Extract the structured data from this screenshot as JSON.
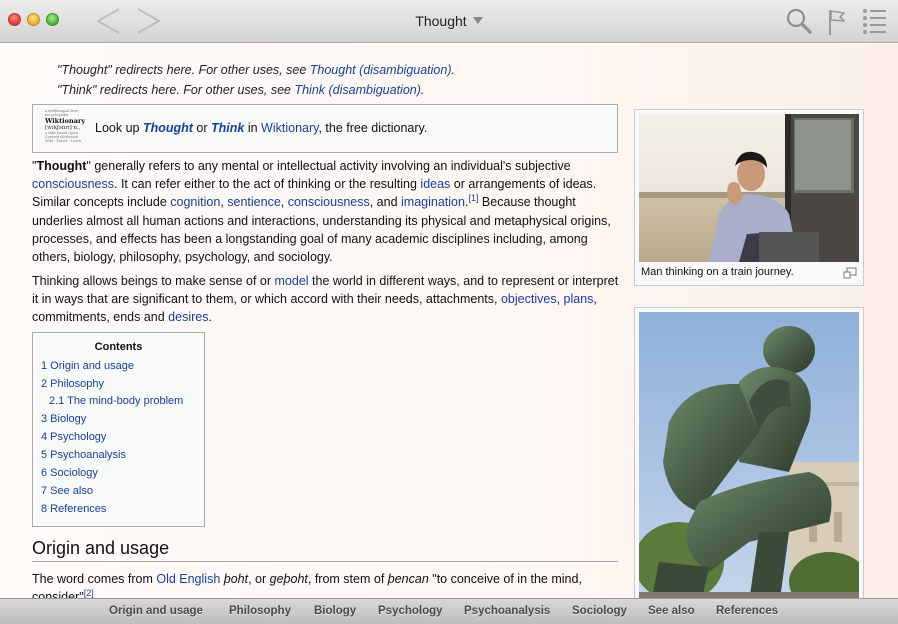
{
  "window": {
    "title": "Thought"
  },
  "hatnotes": [
    {
      "prefix": "\"Thought\" redirects here. For other uses, see ",
      "link": "Thought (disambiguation)",
      "suffix": "."
    },
    {
      "prefix": "\"Think\" redirects here. For other uses, see ",
      "link": "Think (disambiguation)",
      "suffix": "."
    }
  ],
  "wiktionary": {
    "logo_line1": "a multilingual free encyclopedia",
    "logo_title": "Wiktionary",
    "logo_pron": "[wɪkʃənrɪ] n.,",
    "logo_line4": "a wiki-based Open Content dictionary",
    "logo_line5": "Wiki · Travel · Learn",
    "text1": "Look up ",
    "word1": "Thought",
    "text2": " or ",
    "word2": "Think",
    "text3": " in ",
    "link": "Wiktionary",
    "text4": ", the free dictionary."
  },
  "intro": {
    "q1": "\"",
    "bold": "Thought",
    "q2": "\"",
    "t1": " generally refers to any mental or intellectual activity involving an individual's subjective ",
    "l1": "consciousness",
    "t2": ". It can refer either to the act of thinking or the resulting ",
    "l2": "ideas",
    "t3": " or arrangements of ideas. Similar concepts include ",
    "l3": "cognition",
    "t4": ", ",
    "l4": "sentience",
    "t5": ", ",
    "l5": "consciousness",
    "t6": ", and ",
    "l6": "imagination",
    "t7": ".",
    "ref": "[1]",
    "t8": " Because thought underlies almost all human actions and interactions, understanding its physical and metaphysical origins, processes, and effects has been a longstanding goal of many academic disciplines including, among others, biology, philosophy, psychology, and sociology."
  },
  "para2": {
    "t1": "Thinking allows beings to make sense of or ",
    "l1": "model",
    "t2": " the world in different ways, and to represent or interpret it in ways that are significant to them, or which accord with their needs, attachments, ",
    "l2": "objectives",
    "t3": ", ",
    "l3": "plans",
    "t4": ", commitments, ends and ",
    "l4": "desires",
    "t5": "."
  },
  "toc": {
    "title": "Contents",
    "items": [
      "1 Origin and usage",
      "2 Philosophy",
      "2.1 The mind-body problem",
      "3 Biology",
      "4 Psychology",
      "5 Psychoanalysis",
      "6 Sociology",
      "7 See also",
      "8 References"
    ]
  },
  "section": {
    "heading": "Origin and usage",
    "t1": "The word comes from ",
    "l1": "Old English",
    "t2": " ",
    "i1": "þoht",
    "t3": ", or ",
    "i2": "geþoht",
    "t4": ", from stem of ",
    "i3": "þencan",
    "t5": " \"to conceive of in the mind, consider\"",
    "ref": "[2]"
  },
  "images": {
    "caption1": "Man thinking on a train journey."
  },
  "bottom_nav": [
    "Origin and usage",
    "Philosophy",
    "Biology",
    "Psychology",
    "Psychoanalysis",
    "Sociology",
    "See also",
    "References"
  ],
  "icons": {
    "back": "back-arrow-icon",
    "forward": "forward-arrow-icon",
    "search": "magnifier-icon",
    "flag": "flag-icon",
    "toc": "list-icon",
    "enlarge": "enlarge-icon"
  }
}
